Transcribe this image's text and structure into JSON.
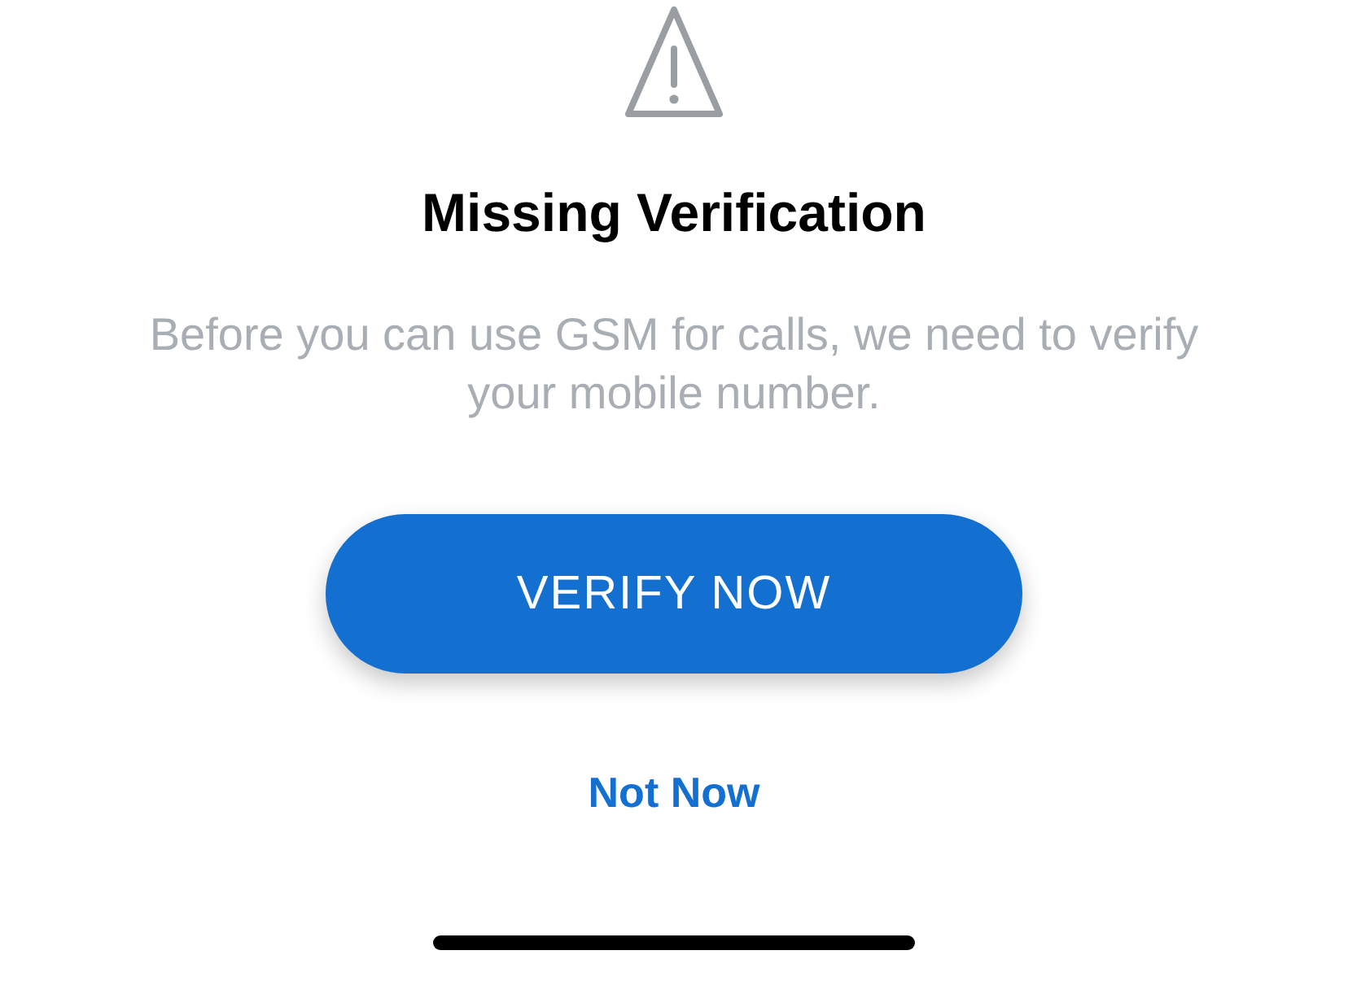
{
  "dialog": {
    "title": "Missing Verification",
    "message": "Before you can use GSM for calls, we need to verify your mobile number.",
    "primary_button": "VERIFY NOW",
    "secondary_button": "Not Now"
  }
}
